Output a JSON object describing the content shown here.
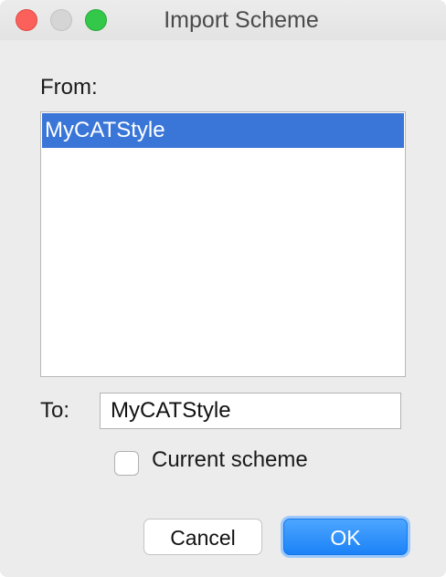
{
  "window": {
    "title": "Import Scheme"
  },
  "from": {
    "label": "From:",
    "items": [
      {
        "label": "MyCATStyle",
        "selected": true
      }
    ]
  },
  "to": {
    "label": "To:",
    "value": "MyCATStyle"
  },
  "current_scheme": {
    "label": "Current scheme",
    "checked": false
  },
  "buttons": {
    "cancel": "Cancel",
    "ok": "OK"
  },
  "colors": {
    "selection": "#3a76d8",
    "primary_button": "#1b82f7",
    "close": "#fc605b",
    "maximize": "#34c84a"
  }
}
